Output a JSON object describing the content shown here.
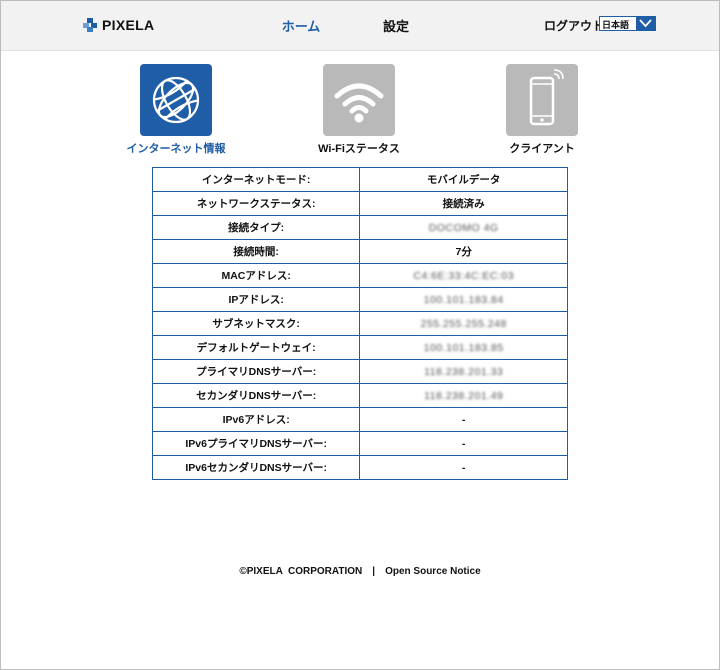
{
  "header": {
    "brand": "PIXELA",
    "nav_home": "ホーム",
    "nav_settings": "設定",
    "logout": "ログアウト",
    "language": "日本語"
  },
  "tiles": {
    "internet_label": "インターネット情報",
    "wifi_label": "Wi-Fiステータス",
    "client_label": "クライアント"
  },
  "table": {
    "rows": [
      {
        "label": "インターネットモード:",
        "value": "モバイルデータ",
        "blurred": false
      },
      {
        "label": "ネットワークステータス:",
        "value": "接続済み",
        "blurred": false
      },
      {
        "label": "接続タイプ:",
        "value": "DOCOMO 4G",
        "blurred": true
      },
      {
        "label": "接続時間:",
        "value": "7分",
        "blurred": false
      },
      {
        "label": "MACアドレス:",
        "value": "C4:6E:33:4C:EC:03",
        "blurred": true
      },
      {
        "label": "IPアドレス:",
        "value": "100.101.183.84",
        "blurred": true
      },
      {
        "label": "サブネットマスク:",
        "value": "255.255.255.248",
        "blurred": true
      },
      {
        "label": "デフォルトゲートウェイ:",
        "value": "100.101.183.85",
        "blurred": true
      },
      {
        "label": "プライマリDNSサーバー:",
        "value": "118.238.201.33",
        "blurred": true
      },
      {
        "label": "セカンダリDNSサーバー:",
        "value": "118.238.201.49",
        "blurred": true
      },
      {
        "label": "IPv6アドレス:",
        "value": "-",
        "blurred": false
      },
      {
        "label": "IPv6プライマリDNSサーバー:",
        "value": "-",
        "blurred": false
      },
      {
        "label": "IPv6セカンダリDNSサーバー:",
        "value": "-",
        "blurred": false
      }
    ]
  },
  "footer": {
    "copyright": "©PIXELA  CORPORATION",
    "separator": "|",
    "oss_notice": "Open Source Notice"
  },
  "colors": {
    "accent": "#1f5da6",
    "tile_inactive": "#b9b9b9",
    "header_bg": "#f2f2f2"
  },
  "icons": {
    "internet": "globe-icon",
    "wifi": "wifi-icon",
    "client": "smartphone-icon"
  }
}
